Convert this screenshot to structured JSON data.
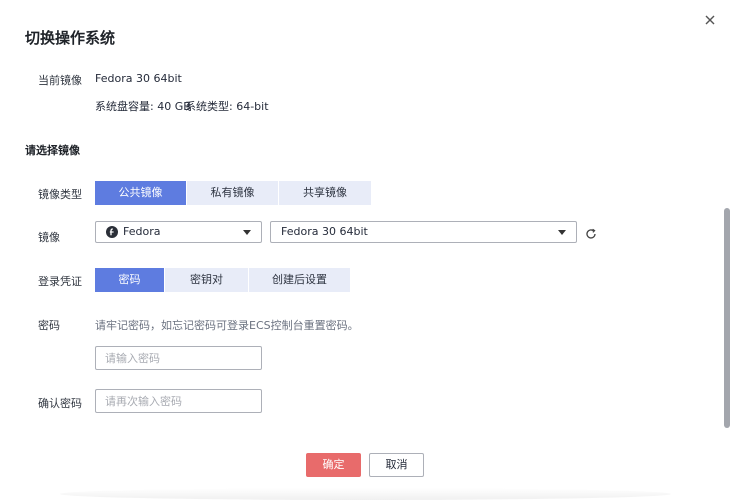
{
  "dialog": {
    "title": "切换操作系统"
  },
  "current_image": {
    "label": "当前镜像",
    "name": "Fedora 30 64bit",
    "disk_label": "系统盘容量: 40 GB",
    "type_label": "系统类型: 64-bit"
  },
  "section_title": "请选择镜像",
  "image_type": {
    "label": "镜像类型",
    "options": [
      "公共镜像",
      "私有镜像",
      "共享镜像"
    ],
    "selected": "公共镜像"
  },
  "image": {
    "label": "镜像",
    "os_select": "Fedora",
    "version_select": "Fedora 30 64bit"
  },
  "credential": {
    "label": "登录凭证",
    "options": [
      "密码",
      "密钥对",
      "创建后设置"
    ],
    "selected": "密码"
  },
  "password": {
    "label": "密码",
    "hint": "请牢记密码，如忘记密码可登录ECS控制台重置密码。",
    "placeholder": "请输入密码"
  },
  "confirm_password": {
    "label": "确认密码",
    "placeholder": "请再次输入密码"
  },
  "footer": {
    "ok_label": "确定",
    "cancel_label": "取消"
  },
  "colors": {
    "accent": "#5e7ce0",
    "danger": "#e86b6b"
  }
}
